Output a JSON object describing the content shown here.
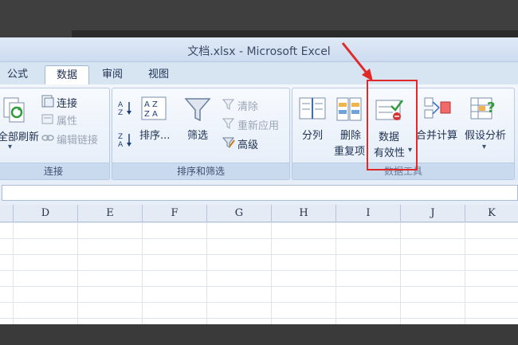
{
  "window": {
    "title": "文档.xlsx - Microsoft Excel"
  },
  "tabs": [
    {
      "label": "公式"
    },
    {
      "label": "数据"
    },
    {
      "label": "审阅"
    },
    {
      "label": "视图"
    }
  ],
  "ribbon": {
    "connections": {
      "refresh_all": "全部刷新",
      "connect": "连接",
      "properties": "属性",
      "edit_links": "编辑链接",
      "label": "连接"
    },
    "sort_filter": {
      "sort": "排序...",
      "filter": "筛选",
      "clear": "清除",
      "reapply": "重新应用",
      "advanced": "高级",
      "label": "排序和筛选"
    },
    "data_tools": {
      "text_to_columns": "分列",
      "remove_dup_1": "删除",
      "remove_dup_2": "重复项",
      "validation_1": "数据",
      "validation_2": "有效性",
      "consolidate": "合并计算",
      "what_if": "假设分析",
      "label": "数据工具"
    }
  },
  "columns": [
    "D",
    "E",
    "F",
    "G",
    "H",
    "I",
    "J",
    "K"
  ],
  "colors": {
    "accent": "#e02a2a"
  }
}
